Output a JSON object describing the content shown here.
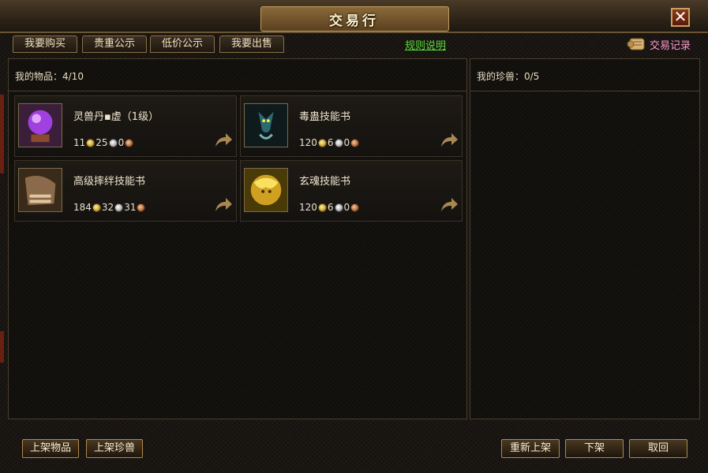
{
  "window": {
    "title": "交易行",
    "close_symbol": "✕"
  },
  "tabs": [
    {
      "label": "我要购买"
    },
    {
      "label": "贵重公示"
    },
    {
      "label": "低价公示"
    },
    {
      "label": "我要出售"
    }
  ],
  "rules_link": "规则说明",
  "trade_records": {
    "label": "交易记录",
    "icon": "scroll-icon"
  },
  "left_panel": {
    "header": "我的物品：4/10"
  },
  "right_panel": {
    "header": "我的珍兽：0/5"
  },
  "items": [
    {
      "name": "灵兽丹▪虚（1级）",
      "icon": "crystal-ball-icon",
      "gold": "11",
      "silver": "25",
      "copper": "0"
    },
    {
      "name": "毒蛊技能书",
      "icon": "serpent-icon",
      "gold": "120",
      "silver": "6",
      "copper": "0"
    },
    {
      "name": "高级摔绊技能书",
      "icon": "fist-icon",
      "gold": "184",
      "silver": "32",
      "copper": "31"
    },
    {
      "name": "玄魂技能书",
      "icon": "golden-spirit-icon",
      "gold": "120",
      "silver": "6",
      "copper": "0"
    }
  ],
  "buttons": {
    "list_item": "上架物品",
    "list_pet": "上架珍兽",
    "relist": "重新上架",
    "delist": "下架",
    "cancel": "取回"
  },
  "colors": {
    "accent_gold": "#c29a5a",
    "link_green": "#5adc3c",
    "records_pink": "#ff9ad0"
  }
}
